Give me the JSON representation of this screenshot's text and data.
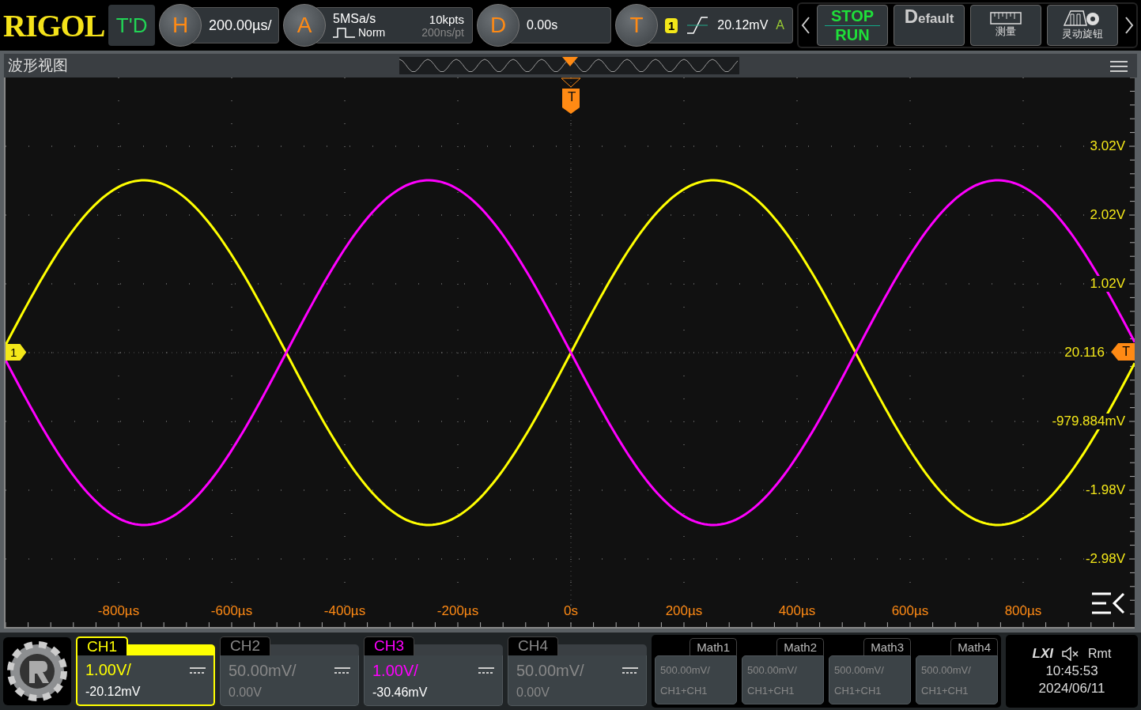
{
  "logo": "RIGOL",
  "toolbar": {
    "mode": "T'D",
    "horizontal": {
      "key": "H",
      "timebase": "200.00µs/"
    },
    "acquire": {
      "key": "A",
      "sample_rate": "5MSa/s",
      "depth": "10kpts",
      "mode": "Norm",
      "resolution": "200ns/pt"
    },
    "delay": {
      "key": "D",
      "value": "0.00s"
    },
    "trigger": {
      "key": "T",
      "source": "1",
      "level": "20.12mV",
      "sweep": "A"
    }
  },
  "buttons": [
    {
      "kind": "runstop",
      "top": "STOP",
      "bottom": "RUN"
    },
    {
      "kind": "default",
      "label": "Default"
    },
    {
      "kind": "ruler",
      "label": "测量"
    },
    {
      "kind": "knob",
      "label": "灵动旋钮"
    }
  ],
  "waveform_view": {
    "title": "波形视图",
    "trigger_marker": "T",
    "channel_marker": "1",
    "trigger_level_marker": "T",
    "trigger_level_label": "20.116",
    "volt_labels": [
      "3.02V",
      "2.02V",
      "1.02V",
      "-979.884mV",
      "-1.98V",
      "-2.98V"
    ],
    "time_labels": [
      "-800µs",
      "-600µs",
      "-400µs",
      "-200µs",
      "0s",
      "200µs",
      "400µs",
      "600µs",
      "800µs"
    ]
  },
  "channels": [
    {
      "name": "CH1",
      "scale": "1.00V/",
      "offset": "-20.12mV",
      "on": true,
      "selected": true,
      "color": "#ffff00"
    },
    {
      "name": "CH2",
      "scale": "50.00mV/",
      "offset": "0.00V",
      "on": false,
      "selected": false
    },
    {
      "name": "CH3",
      "scale": "1.00V/",
      "offset": "-30.46mV",
      "on": true,
      "selected": false,
      "color": "#ff00ff"
    },
    {
      "name": "CH4",
      "scale": "50.00mV/",
      "offset": "0.00V",
      "on": false,
      "selected": false
    }
  ],
  "math": [
    {
      "name": "Math1",
      "scale": "500.00mV/",
      "source": "CH1+CH1"
    },
    {
      "name": "Math2",
      "scale": "500.00mV/",
      "source": "CH1+CH1"
    },
    {
      "name": "Math3",
      "scale": "500.00mV/",
      "source": "CH1+CH1"
    },
    {
      "name": "Math4",
      "scale": "500.00mV/",
      "source": "CH1+CH1"
    }
  ],
  "status": {
    "lxi": "LXI",
    "remote": "Rmt",
    "time": "10:45:53",
    "date": "2024/06/11"
  }
}
